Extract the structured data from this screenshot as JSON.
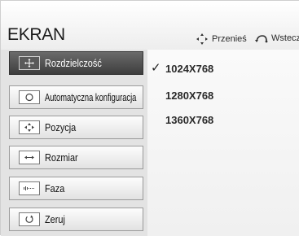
{
  "header": {
    "title": "EKRAN",
    "hint_move": "Przenieś",
    "hint_back": "Wstecz"
  },
  "menu": {
    "items": [
      {
        "label": "Rozdzielczość",
        "icon": "move-cross-icon",
        "selected": true
      },
      {
        "label": "Automatyczna konfiguracja",
        "icon": "auto-config-icon",
        "selected": false
      },
      {
        "label": "Pozycja",
        "icon": "position-icon",
        "selected": false
      },
      {
        "label": "Rozmiar",
        "icon": "size-icon",
        "selected": false
      },
      {
        "label": "Faza",
        "icon": "phase-icon",
        "selected": false
      },
      {
        "label": "Zeruj",
        "icon": "reset-icon",
        "selected": false
      }
    ]
  },
  "options": {
    "selected_index": 0,
    "items": [
      "1024X768",
      "1280X768",
      "1360X768"
    ]
  },
  "colors": {
    "selected_bg": "#4f4f4f",
    "panel_bg": "#e3e3e3"
  }
}
